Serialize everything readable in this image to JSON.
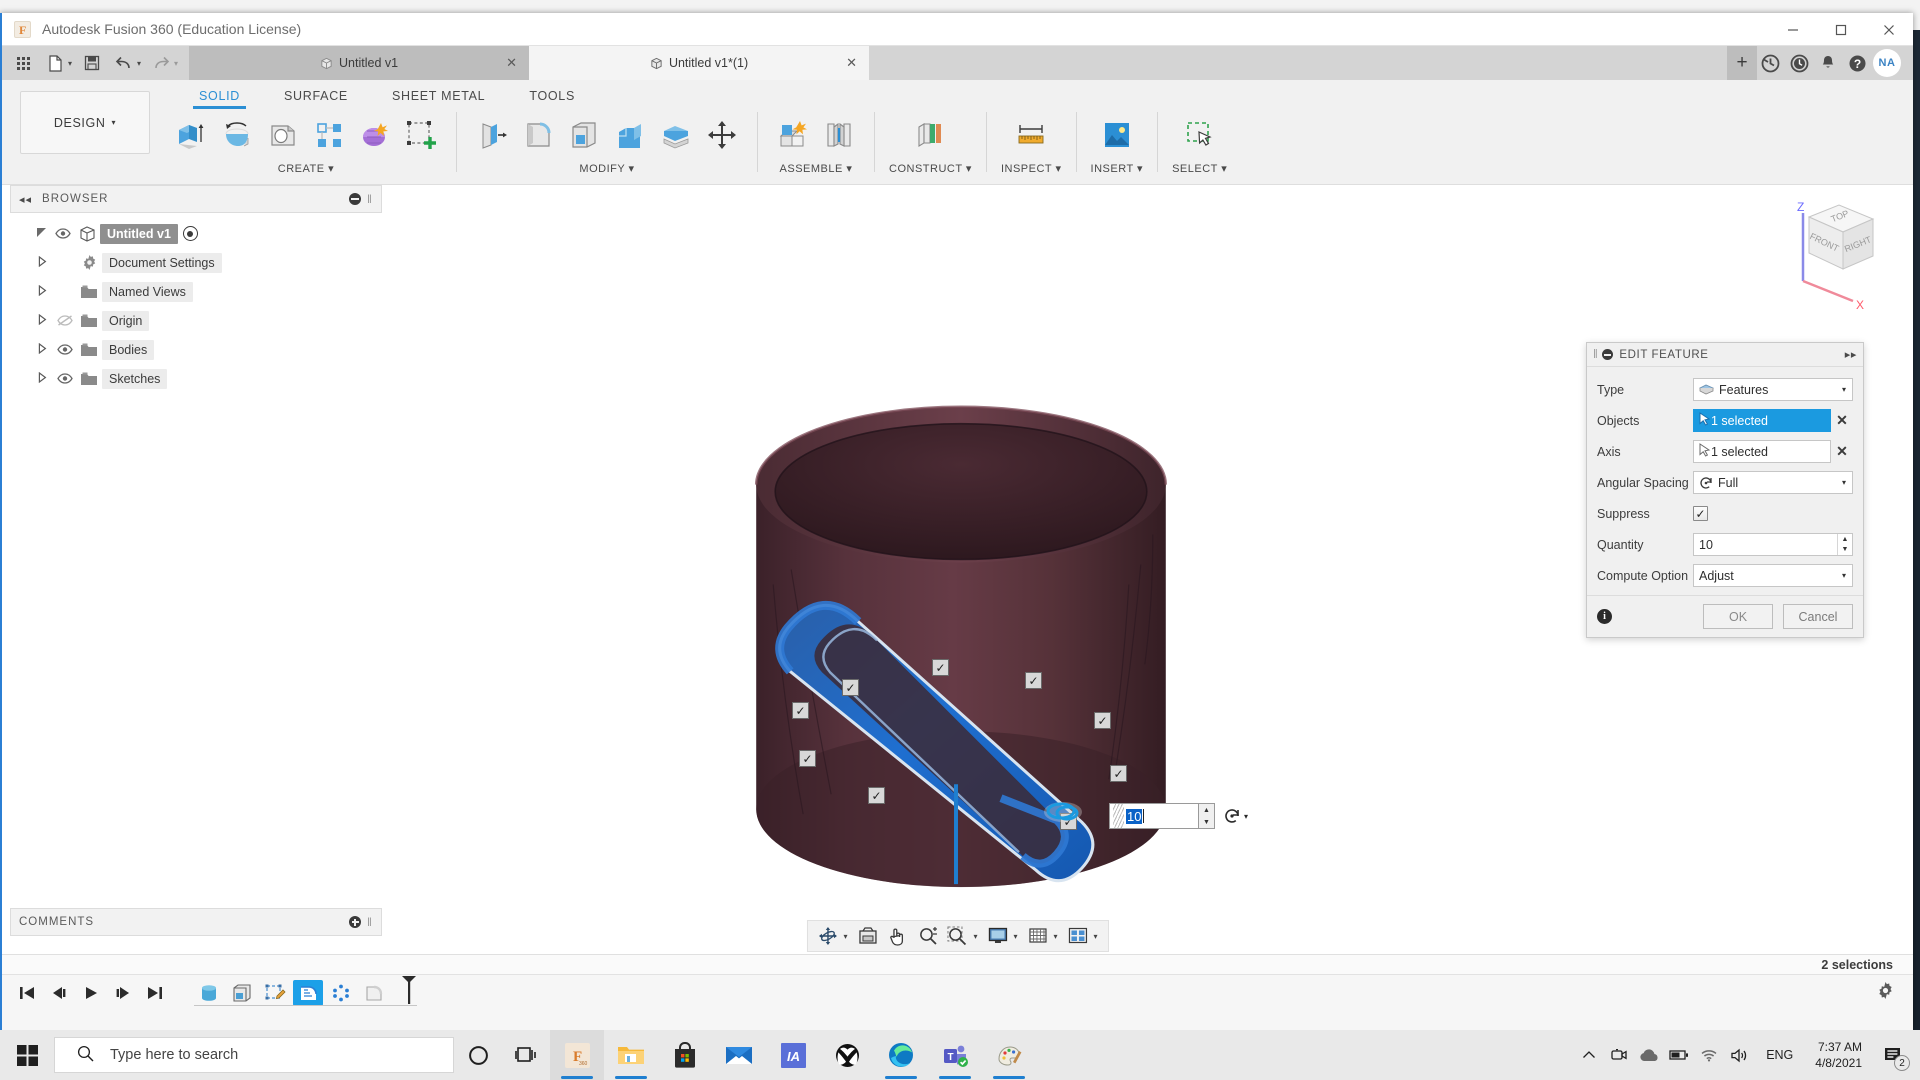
{
  "window": {
    "title": "Autodesk Fusion 360 (Education License)",
    "logo_icon": "fusion-logo-icon",
    "minimize_label": "—",
    "maximize_label": "□",
    "close_label": "✕"
  },
  "quick_access": {
    "app_grid_icon": "app-grid-icon",
    "new_label": "new-file-icon",
    "save_label": "save-icon",
    "undo_label": "undo-icon",
    "redo_label": "redo-icon"
  },
  "doc_tabs": [
    {
      "label": "Untitled v1",
      "active": false,
      "closable": true
    },
    {
      "label": "Untitled v1*(1)",
      "active": true,
      "closable": true
    }
  ],
  "tab_actions": {
    "new_tab": "+",
    "close": "✕",
    "job_status_icon": "job-status-icon",
    "recent_icon": "clock-icon",
    "notifications_icon": "bell-icon",
    "help_icon": "help-icon",
    "avatar_initials": "NA"
  },
  "ribbon": {
    "workspace": "DESIGN",
    "workspace_caret": "▾",
    "tabs": [
      {
        "label": "SOLID",
        "active": true
      },
      {
        "label": "SURFACE",
        "active": false
      },
      {
        "label": "SHEET METAL",
        "active": false
      },
      {
        "label": "TOOLS",
        "active": false
      }
    ],
    "groups": [
      {
        "label": "CREATE",
        "caret": "▾",
        "icons": [
          "extrude-icon",
          "revolve-icon",
          "sweep-icon",
          "pattern-icon",
          "form-icon",
          "create-sketch-icon"
        ]
      },
      {
        "label": "MODIFY",
        "caret": "▾",
        "icons": [
          "press-pull-icon",
          "fillet-icon",
          "shell-icon",
          "combine-icon",
          "offset-face-icon",
          "move-copy-icon"
        ]
      },
      {
        "label": "ASSEMBLE",
        "caret": "▾",
        "icons": [
          "new-component-icon",
          "joint-icon"
        ]
      },
      {
        "label": "CONSTRUCT",
        "caret": "▾",
        "icons": [
          "offset-plane-icon"
        ]
      },
      {
        "label": "INSPECT",
        "caret": "▾",
        "icons": [
          "measure-icon"
        ]
      },
      {
        "label": "INSERT",
        "caret": "▾",
        "icons": [
          "insert-image-icon"
        ]
      },
      {
        "label": "SELECT",
        "caret": "▾",
        "icons": [
          "select-window-icon"
        ]
      }
    ]
  },
  "browser": {
    "title": "BROWSER",
    "collapse_icon": "double-left-arrow-icon",
    "minus_icon": "collapse-circle-icon",
    "grip_icon": "grip-icon",
    "nodes": [
      {
        "label": "Untitled v1",
        "root": true,
        "expander": "◢",
        "visibility": "eye-icon",
        "icon": "component-icon",
        "radio": true
      },
      {
        "label": "Document Settings",
        "root": false,
        "expander": "▷",
        "visibility": "",
        "icon": "gear-icon",
        "radio": false
      },
      {
        "label": "Named Views",
        "root": false,
        "expander": "▷",
        "visibility": "",
        "icon": "folder-icon",
        "radio": false
      },
      {
        "label": "Origin",
        "root": false,
        "expander": "▷",
        "visibility": "eye-off-icon",
        "icon": "folder-icon",
        "radio": false
      },
      {
        "label": "Bodies",
        "root": false,
        "expander": "▷",
        "visibility": "eye-icon",
        "icon": "folder-icon",
        "radio": false
      },
      {
        "label": "Sketches",
        "root": false,
        "expander": "▷",
        "visibility": "eye-icon",
        "icon": "folder-icon",
        "radio": false
      }
    ]
  },
  "comments": {
    "title": "COMMENTS",
    "add_icon": "add-comment-icon",
    "grip_icon": "grip-icon"
  },
  "dialog": {
    "title": "EDIT FEATURE",
    "collapse_icon": "collapse-circle-icon",
    "expand_icon": "double-right-arrow-icon",
    "rows": [
      {
        "label": "Type",
        "kind": "select",
        "value": "Features",
        "icon": "features-icon",
        "caret": "▾"
      },
      {
        "label": "Objects",
        "kind": "selection",
        "value": "1 selected",
        "highlighted": true,
        "icon": "cursor-arrow-icon",
        "clear": "✕"
      },
      {
        "label": "Axis",
        "kind": "selection",
        "value": "1 selected",
        "highlighted": false,
        "icon": "cursor-arrow-icon",
        "clear": "✕"
      },
      {
        "label": "Angular Spacing",
        "kind": "select",
        "value": "Full",
        "icon": "angular-spacing-icon",
        "caret": "▾"
      },
      {
        "label": "Suppress",
        "kind": "checkbox",
        "value": "✓",
        "checked": true
      },
      {
        "label": "Quantity",
        "kind": "spinner",
        "value": "10"
      },
      {
        "label": "Compute Option",
        "kind": "select",
        "value": "Adjust",
        "icon": "",
        "caret": "▾"
      }
    ],
    "info_icon": "info-icon",
    "ok_label": "OK",
    "cancel_label": "Cancel"
  },
  "canvas_input": {
    "value": "10",
    "spin_up": "▲",
    "spin_down": "▼",
    "rotate_icon": "rotate-icon",
    "rotate_caret": "▾",
    "marker_count": 9,
    "marker_glyph": "✓"
  },
  "viewcube": {
    "top_label": "TOP",
    "front_label": "FRONT",
    "right_label": "RIGHT",
    "z_label": "Z",
    "x_label": "X"
  },
  "model": {
    "body_color": "#4a2b33",
    "feature_color": "#1f6fd0"
  },
  "nav_toolbar": {
    "buttons": [
      {
        "icon": "orbit-icon",
        "caret": "▾"
      },
      {
        "icon": "look-at-icon",
        "caret": ""
      },
      {
        "icon": "pan-icon",
        "caret": ""
      },
      {
        "icon": "zoom-icon",
        "caret": ""
      },
      {
        "icon": "zoom-window-icon",
        "caret": "▾"
      },
      {
        "icon": "display-settings-icon",
        "caret": "▾"
      },
      {
        "icon": "grid-snaps-icon",
        "caret": "▾"
      },
      {
        "icon": "viewports-icon",
        "caret": "▾"
      }
    ]
  },
  "status": {
    "selections": "2 selections"
  },
  "timeline": {
    "playback": [
      "skip-start-icon",
      "step-back-icon",
      "play-icon",
      "step-forward-icon",
      "skip-end-icon"
    ],
    "features": [
      {
        "icon": "cylinder-feature-icon",
        "selected": false
      },
      {
        "icon": "shell-feature-icon",
        "selected": false
      },
      {
        "icon": "sketch-feature-icon",
        "selected": false
      },
      {
        "icon": "pattern-feature-icon",
        "selected": true
      },
      {
        "icon": "circular-pattern-icon",
        "selected": false
      },
      {
        "icon": "fillet-feature-icon",
        "selected": false
      }
    ],
    "end_marker": "timeline-end-marker",
    "settings_icon": "gear-icon"
  },
  "taskbar": {
    "start_icon": "windows-start-icon",
    "search_placeholder": "Type here to search",
    "search_icon": "search-icon",
    "cortana_icon": "cortana-icon",
    "taskview_icon": "task-view-icon",
    "apps": [
      {
        "name": "fusion-360-icon",
        "open": true,
        "active": true
      },
      {
        "name": "file-explorer-icon",
        "open": true,
        "active": false
      },
      {
        "name": "microsoft-store-icon",
        "open": false,
        "active": false
      },
      {
        "name": "mail-icon",
        "open": false,
        "active": false
      },
      {
        "name": "autodesk-icon",
        "open": false,
        "active": false
      },
      {
        "name": "xbox-icon",
        "open": false,
        "active": false
      },
      {
        "name": "microsoft-edge-icon",
        "open": true,
        "active": false
      },
      {
        "name": "microsoft-teams-icon",
        "open": true,
        "active": false
      },
      {
        "name": "paint-icon",
        "open": true,
        "active": false
      }
    ],
    "tray": [
      "show-hidden-icons",
      "screen-recorder-icon",
      "onedrive-icon",
      "battery-icon",
      "wifi-icon",
      "volume-icon"
    ],
    "language": "ENG",
    "time": "7:37 AM",
    "date": "4/8/2021",
    "notification_count": "2",
    "notification_icon": "action-center-icon"
  }
}
